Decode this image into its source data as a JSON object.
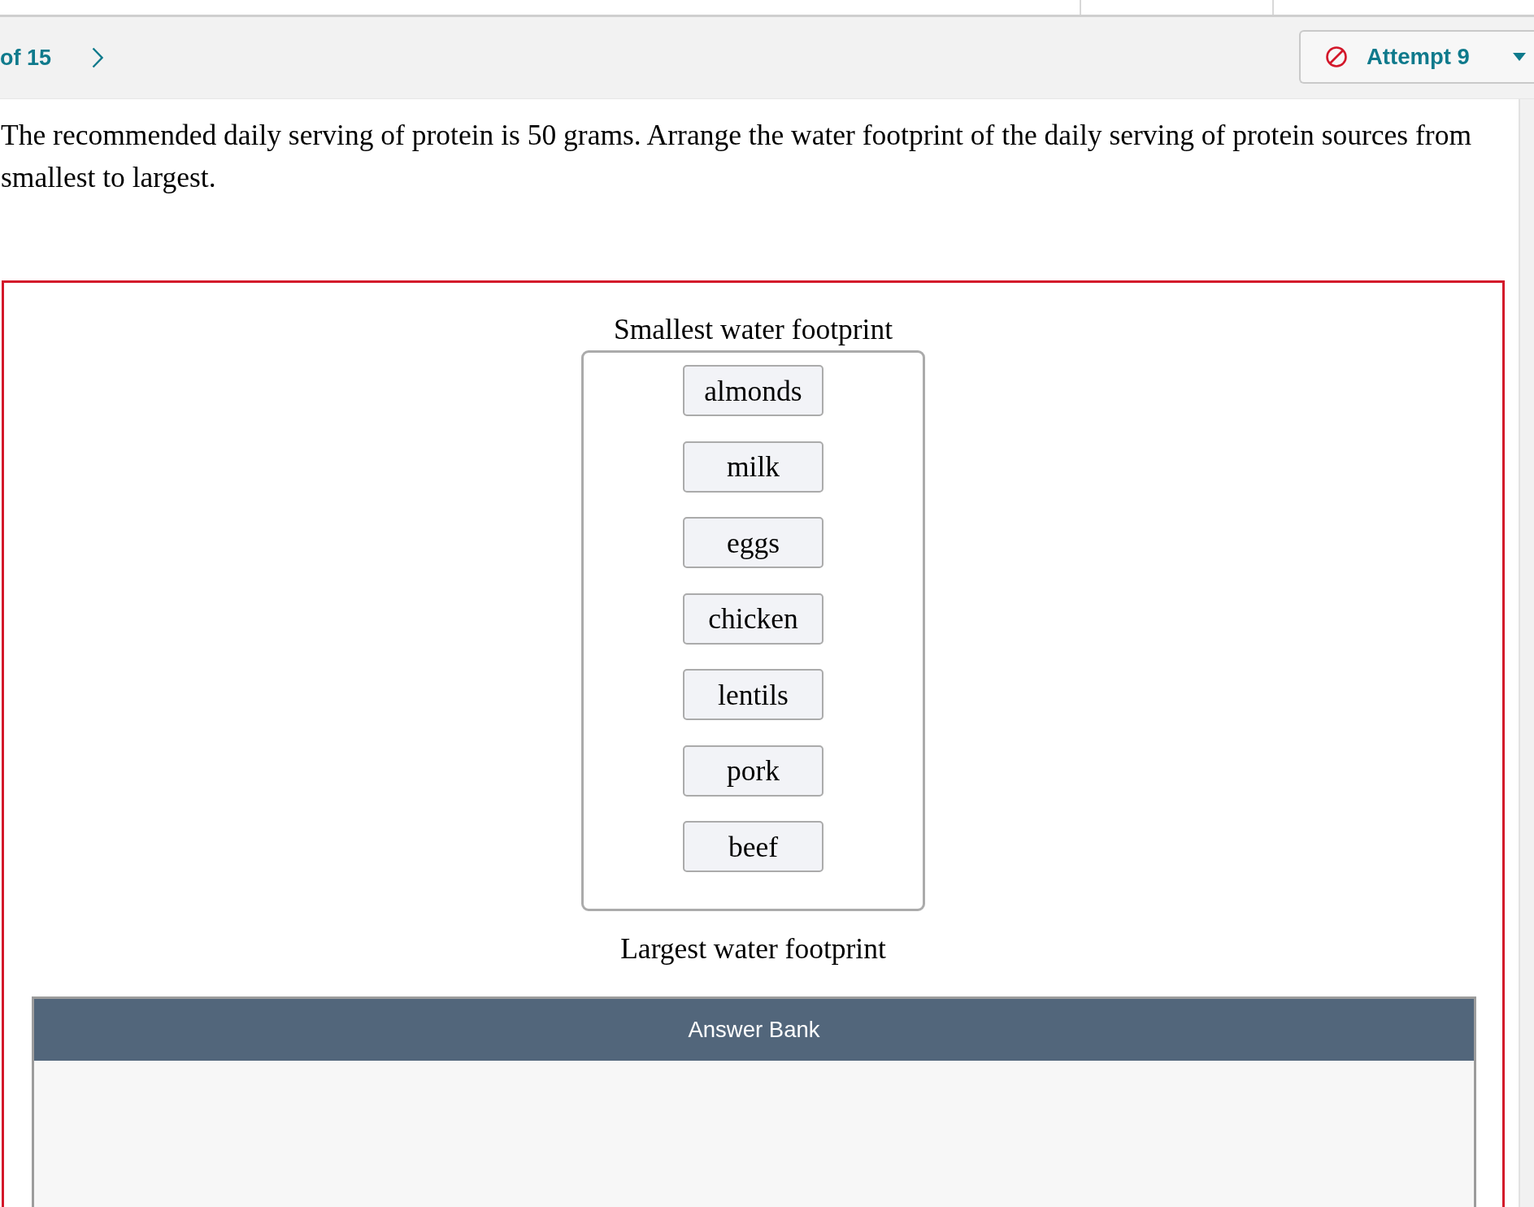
{
  "header": {
    "question_position": "of 15",
    "attempt": {
      "label": "Attempt 9"
    }
  },
  "question": {
    "text": "The recommended daily serving of protein is 50 grams. Arrange the water footprint of the daily serving of protein sources from smallest to largest."
  },
  "response": {
    "incorrect": true,
    "top_label": "Smallest water footprint",
    "items": [
      {
        "label": "almonds"
      },
      {
        "label": "milk"
      },
      {
        "label": "eggs"
      },
      {
        "label": "chicken"
      },
      {
        "label": "lentils"
      },
      {
        "label": "pork"
      },
      {
        "label": "beef"
      }
    ],
    "bottom_label": "Largest water footprint"
  },
  "answer_bank": {
    "title": "Answer Bank"
  }
}
